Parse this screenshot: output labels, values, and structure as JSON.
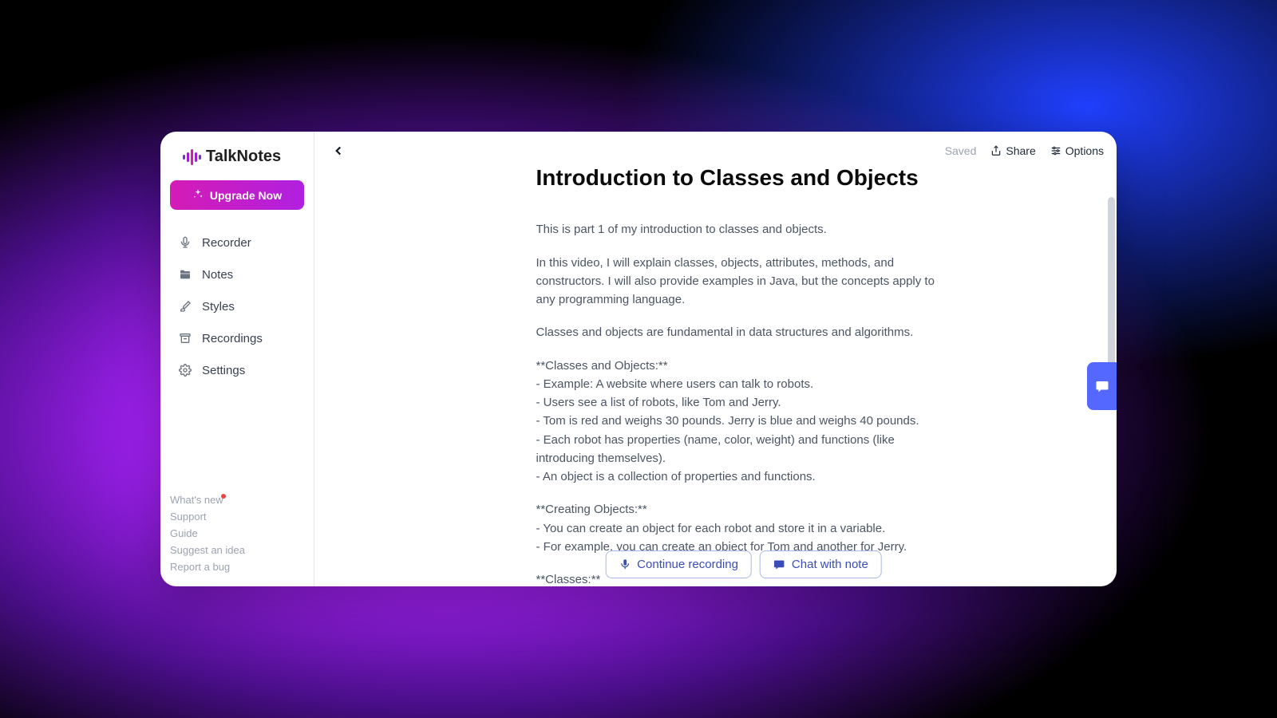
{
  "brand": "TalkNotes",
  "upgrade_label": "Upgrade Now",
  "nav": [
    {
      "id": "recorder",
      "label": "Recorder"
    },
    {
      "id": "notes",
      "label": "Notes"
    },
    {
      "id": "styles",
      "label": "Styles"
    },
    {
      "id": "recordings",
      "label": "Recordings"
    },
    {
      "id": "settings",
      "label": "Settings"
    }
  ],
  "footer_links": {
    "whats_new": "What's new",
    "support": "Support",
    "guide": "Guide",
    "suggest": "Suggest an idea",
    "report": "Report a bug"
  },
  "topbar": {
    "saved": "Saved",
    "share": "Share",
    "options": "Options"
  },
  "note": {
    "title": "Introduction to Classes and Objects",
    "p1": "This is part 1 of my introduction to classes and objects.",
    "p2": "In this video, I will explain classes, objects, attributes, methods, and constructors. I will also provide examples in Java, but the concepts apply to any programming language.",
    "p3": "Classes and objects are fundamental in data structures and algorithms.",
    "p4": "**Classes and Objects:**\n- Example: A website where users can talk to robots.\n- Users see a list of robots, like Tom and Jerry.\n- Tom is red and weighs 30 pounds. Jerry is blue and weighs 40 pounds.\n- Each robot has properties (name, color, weight) and functions (like introducing themselves).\n- An object is a collection of properties and functions.",
    "p5": "**Creating Objects:**\n- You can create an object for each robot and store it in a variable.\n- For example, you can create an object for Tom and another for Jerry.",
    "p6": "**Classes:**\n- A class is a blueprint for creating objects.\n- It defines the properties and functions that objects will have."
  },
  "actions": {
    "continue_recording": "Continue recording",
    "chat_with_note": "Chat with note"
  }
}
